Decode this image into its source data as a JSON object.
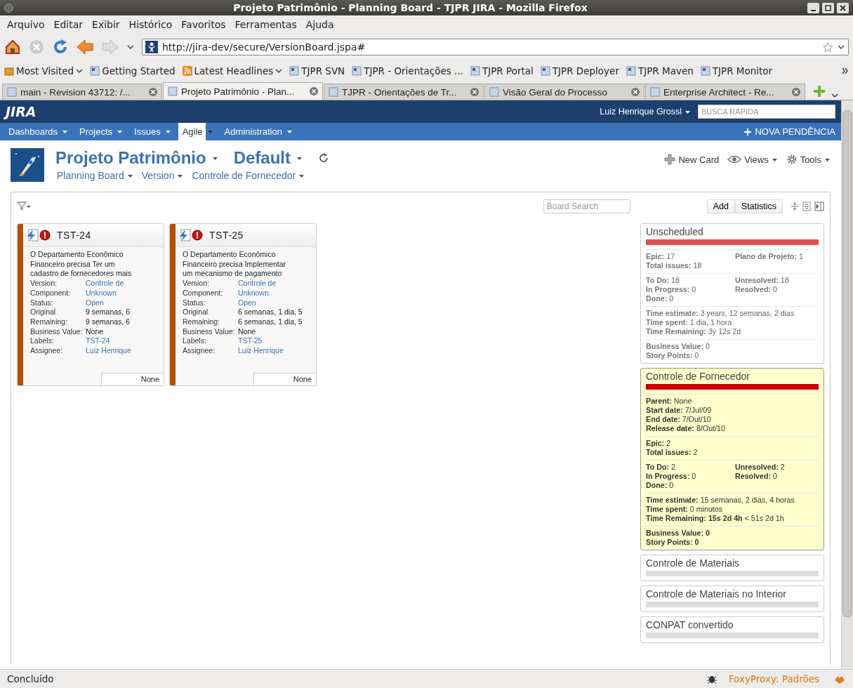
{
  "window": {
    "title": "Projeto Patrimônio - Planning Board - TJPR JIRA - Mozilla Firefox"
  },
  "menu_bar": [
    "Arquivo",
    "Editar",
    "Exibir",
    "Histórico",
    "Favoritos",
    "Ferramentas",
    "Ajuda"
  ],
  "address_bar": {
    "value": "http://jira-dev/secure/VersionBoard.jspa#"
  },
  "bookmarks": [
    {
      "label": "Most Visited",
      "kind": "folder"
    },
    {
      "label": "Getting Started",
      "kind": "link"
    },
    {
      "label": "Latest Headlines",
      "kind": "feed"
    },
    {
      "label": "TJPR SVN",
      "kind": "link"
    },
    {
      "label": "TJPR - Orientações ...",
      "kind": "link"
    },
    {
      "label": "TJPR Portal",
      "kind": "link"
    },
    {
      "label": "TJPR Deployer",
      "kind": "link"
    },
    {
      "label": "TJPR Maven",
      "kind": "link"
    },
    {
      "label": "TJPR Monitor",
      "kind": "link"
    }
  ],
  "tabs": [
    {
      "label": "main - Revision 43712: /...",
      "selected": false
    },
    {
      "label": "Projeto Patrimônio - Plan...",
      "selected": true
    },
    {
      "label": "TJPR - Orientações de Tr...",
      "selected": false
    },
    {
      "label": "Visão Geral do Processo",
      "selected": false
    },
    {
      "label": "Enterprise Architect - Re...",
      "selected": false
    }
  ],
  "jira_header": {
    "logo": "JIRA",
    "user": "Luiz Henrique Grossl",
    "search": {
      "placeholder": "BUSCA RÁPIDA"
    }
  },
  "jira_nav": {
    "items": [
      {
        "label": "Dashboards",
        "selected": false
      },
      {
        "label": "Projects",
        "selected": false
      },
      {
        "label": "Issues",
        "selected": false
      },
      {
        "label": "Agile",
        "selected": true
      },
      {
        "label": "Administration",
        "selected": false
      }
    ],
    "action": "NOVA PENDÊNCIA"
  },
  "project": {
    "title": "Projeto Patrimônio",
    "board": "Default",
    "subnav": [
      "Planning Board",
      "Version",
      "Controle de Fornecedor"
    ],
    "actions": [
      "New Card",
      "Views",
      "Tools"
    ]
  },
  "board": {
    "search": {
      "placeholder": "Board Search"
    },
    "buttons": [
      "Add",
      "Statistics"
    ]
  },
  "cards": [
    {
      "key": "TST-24",
      "summary": "O Departamento Econômico Financeiro precisa Ter um cadastro de fornecedores mais",
      "footer": "None",
      "fields": [
        {
          "label": "Version:",
          "value": "Controle de",
          "kind": "link"
        },
        {
          "label": "Component:",
          "value": "Unknown",
          "kind": "link"
        },
        {
          "label": "Status:",
          "value": "Open",
          "kind": "link"
        },
        {
          "label": "Original",
          "value": "9 semanas, 6",
          "kind": "plain"
        },
        {
          "label": "Remaining:",
          "value": "9 semanas, 6",
          "kind": "plain"
        },
        {
          "label": "Business Value:",
          "value": "None",
          "kind": "plain"
        },
        {
          "label": "Labels:",
          "value": "TST-24",
          "kind": "link"
        },
        {
          "label": "Assignee:",
          "value": "Luiz Henrique",
          "kind": "link"
        }
      ]
    },
    {
      "key": "TST-25",
      "summary": "O Departamento Econômico Financeiro precisa Implementar um mecanismo de pagamento",
      "footer": "None",
      "fields": [
        {
          "label": "Version:",
          "value": "Controle de",
          "kind": "link"
        },
        {
          "label": "Component:",
          "value": "Unknown",
          "kind": "link"
        },
        {
          "label": "Status:",
          "value": "Open",
          "kind": "link"
        },
        {
          "label": "Original",
          "value": "6 semanas, 1 dia, 5",
          "kind": "plain"
        },
        {
          "label": "Remaining:",
          "value": "6 semanas, 1 dia, 5",
          "kind": "plain"
        },
        {
          "label": "Business Value:",
          "value": "None",
          "kind": "plain"
        },
        {
          "label": "Labels:",
          "value": "TST-25",
          "kind": "link"
        },
        {
          "label": "Assignee:",
          "value": "Luiz Henrique",
          "kind": "link"
        }
      ]
    }
  ],
  "versions": [
    {
      "title": "Unscheduled",
      "selected": false,
      "color": "#e05050",
      "sections": [
        {
          "kind": "pairs",
          "stats": [
            {
              "label": "Epic:",
              "value": "17"
            },
            {
              "label": "Plano de Projeto:",
              "value": "1"
            },
            {
              "label": "Total issues:",
              "value": "18"
            }
          ]
        },
        {
          "kind": "pairs",
          "stats": [
            {
              "label": "To Do:",
              "value": "18"
            },
            {
              "label": "Unresolved:",
              "value": "18"
            },
            {
              "label": "In Progress:",
              "value": "0"
            },
            {
              "label": "Resolved:",
              "value": "0"
            },
            {
              "label": "Done:",
              "value": "0"
            }
          ]
        },
        {
          "kind": "list",
          "stats": [
            {
              "label": "Time estimate:",
              "value": "3 years, 12 semanas, 2 dias"
            },
            {
              "label": "Time spent:",
              "value": "1 dia, 1 hora"
            },
            {
              "label": "Time Remaining:",
              "value": "3y 12s 2d"
            }
          ]
        },
        {
          "kind": "list",
          "stats": [
            {
              "label": "Business Value:",
              "value": "0"
            },
            {
              "label": "Story Points:",
              "value": "0"
            }
          ]
        }
      ]
    },
    {
      "title": "Controle de Fornecedor",
      "selected": true,
      "color": "#cc0000",
      "sections": [
        {
          "kind": "list",
          "stats": [
            {
              "label": "Parent:",
              "value": "None"
            },
            {
              "label": "Start date:",
              "value": "7/Jul/09"
            },
            {
              "label": "End date:",
              "value": "7/Out/10"
            },
            {
              "label": "Release date:",
              "value": "8/Out/10"
            }
          ]
        },
        {
          "kind": "list",
          "stats": [
            {
              "label": "Epic:",
              "value": "2"
            },
            {
              "label": "Total issues:",
              "value": "2"
            }
          ]
        },
        {
          "kind": "pairs",
          "stats": [
            {
              "label": "To Do:",
              "value": "2"
            },
            {
              "label": "Unresolved:",
              "value": "2"
            },
            {
              "label": "In Progress:",
              "value": "0"
            },
            {
              "label": "Resolved:",
              "value": "0"
            },
            {
              "label": "Done:",
              "value": "0"
            }
          ]
        },
        {
          "kind": "list",
          "stats": [
            {
              "label": "Time estimate:",
              "value": "15 semanas, 2 dias, 4 horas"
            },
            {
              "label": "Time spent:",
              "value": "0 minutos"
            },
            {
              "label": "Time Remaining:",
              "value": "**15s 2d 4h** < 51s 2d 1h"
            }
          ]
        },
        {
          "kind": "list",
          "stats": [
            {
              "label": "Business Value:",
              "value": "**0**"
            },
            {
              "label": "Story Points:",
              "value": "**0**"
            }
          ]
        }
      ]
    },
    {
      "title": "Controle de Materiais",
      "selected": false,
      "color": "#dddddd"
    },
    {
      "title": "Controle de Materiais no Interior",
      "selected": false,
      "color": "#dddddd"
    },
    {
      "title": "CONPAT convertido",
      "selected": false,
      "color": "#dddddd"
    }
  ],
  "status_bar": {
    "text": "Concluído",
    "proxy": "FoxyProxy: Padrões"
  }
}
